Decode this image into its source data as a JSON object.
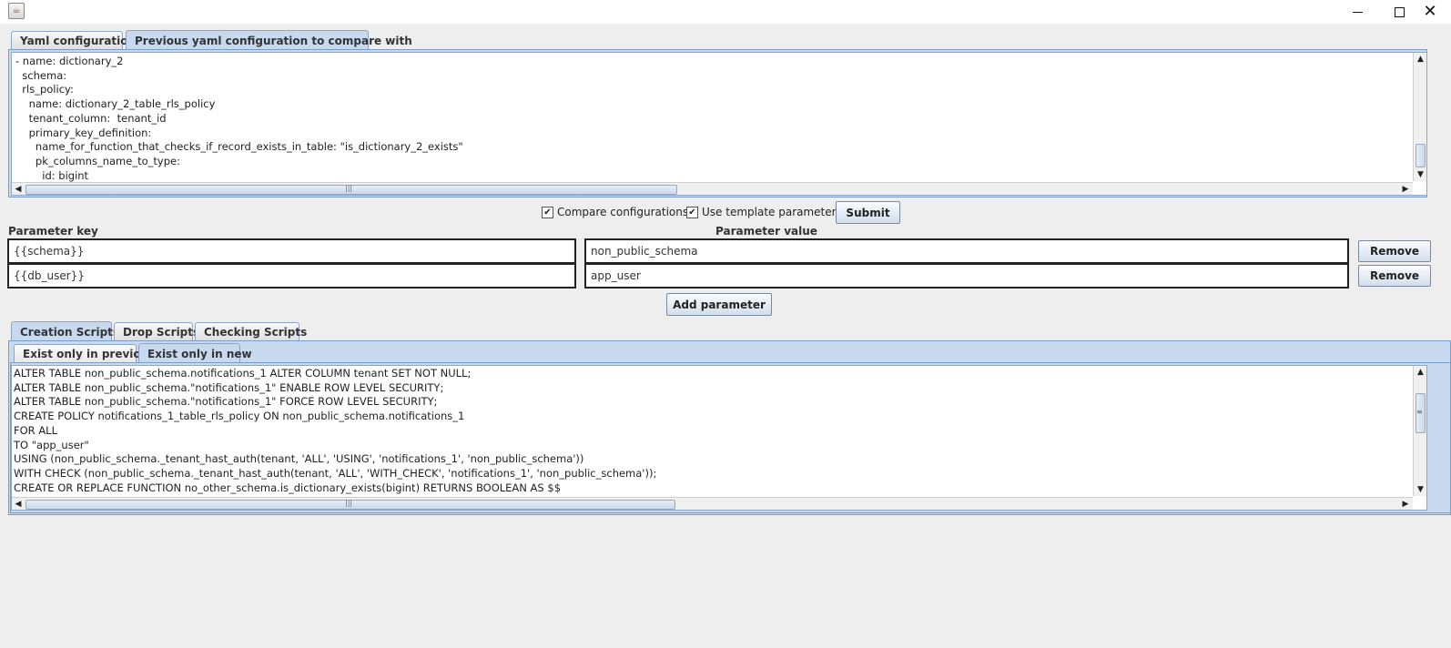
{
  "window": {
    "icon": "java-cup-icon",
    "min_glyph": "",
    "max_glyph": "",
    "close_glyph": "✕"
  },
  "top_tabs": [
    {
      "label": "Yaml configuration"
    },
    {
      "label": "Previous yaml configuration to compare with"
    }
  ],
  "yaml_editor": {
    "lines": [
      "- name: dictionary_2",
      "  schema:",
      "  rls_policy:",
      "    name: dictionary_2_table_rls_policy",
      "    tenant_column:  tenant_id",
      "    primary_key_definition:",
      "      name_for_function_that_checks_if_record_exists_in_table: \"is_dictionary_2_exists\"",
      "      pk_columns_name_to_type:",
      "        id: bigint"
    ]
  },
  "options": {
    "compare_label": "Compare configurations",
    "compare_checked": "✔",
    "template_label": "Use template parameters",
    "template_checked": "✔",
    "submit_label": "Submit"
  },
  "params": {
    "key_header": "Parameter key",
    "value_header": "Parameter value",
    "rows": [
      {
        "key": "{{schema}}",
        "value": "non_public_schema",
        "remove": "Remove"
      },
      {
        "key": "{{db_user}}",
        "value": "app_user",
        "remove": "Remove"
      }
    ],
    "add_label": "Add parameter"
  },
  "script_tabs": [
    {
      "label": "Creation Scripts"
    },
    {
      "label": "Drop Scripts"
    },
    {
      "label": "Checking Scripts"
    }
  ],
  "sub_tabs": [
    {
      "label": "Exist only in previous"
    },
    {
      "label": "Exist only in new"
    }
  ],
  "scripts": {
    "lines": [
      "ALTER TABLE non_public_schema.notifications_1 ALTER COLUMN tenant SET NOT NULL;",
      "ALTER TABLE non_public_schema.\"notifications_1\" ENABLE ROW LEVEL SECURITY;",
      "ALTER TABLE non_public_schema.\"notifications_1\" FORCE ROW LEVEL SECURITY;",
      "CREATE POLICY notifications_1_table_rls_policy ON non_public_schema.notifications_1",
      "FOR ALL",
      "TO \"app_user\"",
      "USING (non_public_schema._tenant_hast_auth(tenant, 'ALL', 'USING', 'notifications_1', 'non_public_schema'))",
      "WITH CHECK (non_public_schema._tenant_hast_auth(tenant, 'ALL', 'WITH_CHECK', 'notifications_1', 'non_public_schema'));",
      "CREATE OR REPLACE FUNCTION no_other_schema.is_dictionary_exists(bigint) RETURNS BOOLEAN AS $$"
    ]
  },
  "scroll_glyphs": {
    "up": "▲",
    "down": "▼",
    "left": "◀",
    "right": "▶",
    "grip_h": "|||",
    "grip_v": "≡"
  }
}
